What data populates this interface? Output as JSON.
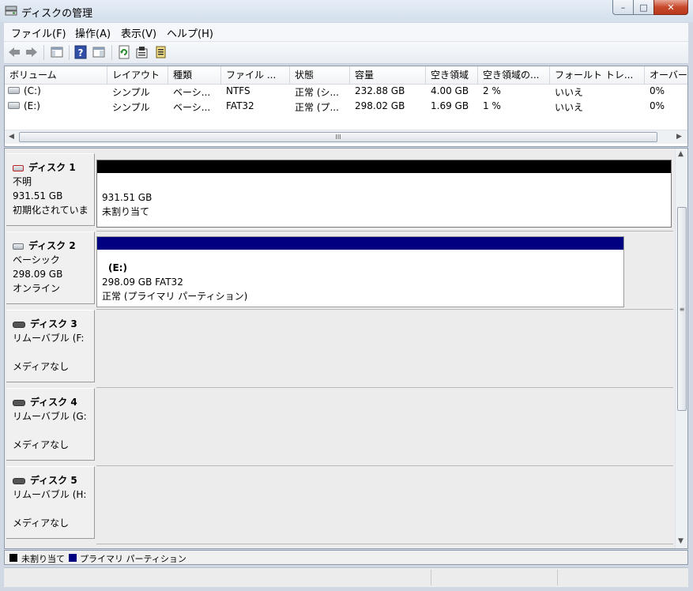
{
  "window": {
    "title": "ディスクの管理"
  },
  "menu": [
    "ファイル(F)",
    "操作(A)",
    "表示(V)",
    "ヘルプ(H)"
  ],
  "toolbar": {
    "icons": [
      "back-arrow-icon",
      "forward-arrow-icon",
      "console-tree-icon",
      "help-icon",
      "show-pane-icon",
      "refresh-icon",
      "properties-icon",
      "export-list-icon"
    ]
  },
  "volume_list": {
    "columns": [
      "ボリューム",
      "レイアウト",
      "種類",
      "ファイル ...",
      "状態",
      "容量",
      "空き領域",
      "空き領域の...",
      "フォールト トレ...",
      "オーバー"
    ],
    "rows": [
      [
        "(C:)",
        "シンプル",
        "ベーシ...",
        "NTFS",
        "正常 (シ...",
        "232.88 GB",
        "4.00 GB",
        "2 %",
        "いいえ",
        "0%"
      ],
      [
        "(E:)",
        "シンプル",
        "ベーシ...",
        "FAT32",
        "正常 (プ...",
        "298.02 GB",
        "1.69 GB",
        "1 %",
        "いいえ",
        "0%"
      ]
    ],
    "scroll_grip": "III"
  },
  "disks": [
    {
      "title": "ディスク 1",
      "line1": "不明",
      "line2": "931.51 GB",
      "line3": "初期化されていま",
      "partition": {
        "name": "",
        "size": "931.51 GB",
        "status": "未割り当て",
        "color": "#000000"
      }
    },
    {
      "title": "ディスク 2",
      "line1": "ベーシック",
      "line2": "298.09 GB",
      "line3": "オンライン",
      "partition": {
        "name": "(E:)",
        "size": "298.09 GB FAT32",
        "status": "正常 (プライマリ パーティション)",
        "color": "#000080"
      }
    },
    {
      "title": "ディスク 3",
      "line1": "リムーバブル (F:",
      "line2": "",
      "line3": "メディアなし"
    },
    {
      "title": "ディスク 4",
      "line1": "リムーバブル (G:",
      "line2": "",
      "line3": "メディアなし"
    },
    {
      "title": "ディスク 5",
      "line1": "リムーバブル (H:",
      "line2": "",
      "line3": "メディアなし"
    }
  ],
  "legend": [
    {
      "label": "未割り当て",
      "color": "#000000"
    },
    {
      "label": "プライマリ パーティション",
      "color": "#000080"
    }
  ],
  "colors": {
    "unallocated": "#000000",
    "primary": "#000080",
    "close": "#c8482c"
  }
}
